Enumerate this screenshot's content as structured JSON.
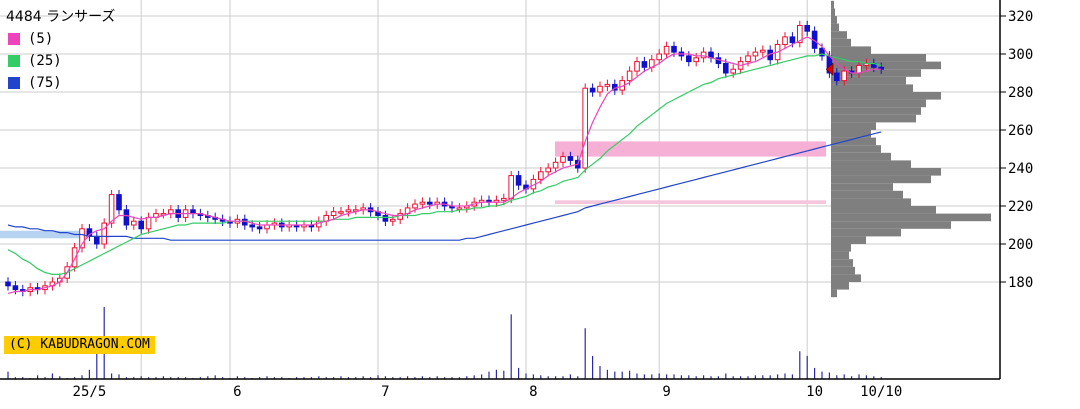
{
  "legend": {
    "title": "4484 ランサーズ",
    "items": [
      {
        "label": "(5)",
        "color": "#ee44bb"
      },
      {
        "label": "(25)",
        "color": "#33cc66"
      },
      {
        "label": "(75)",
        "color": "#2244cc"
      }
    ]
  },
  "credit": "(C) KABUDRAGON.COM",
  "chart_data": {
    "type": "candlestick",
    "ylim": [
      160,
      330
    ],
    "yticks": [
      180,
      200,
      220,
      240,
      260,
      280,
      300,
      320
    ],
    "x_labels": [
      {
        "label": "25/5",
        "index": 11
      },
      {
        "label": "6",
        "index": 31
      },
      {
        "label": "7",
        "index": 51
      },
      {
        "label": "8",
        "index": 71
      },
      {
        "label": "9",
        "index": 89
      },
      {
        "label": "10",
        "index": 109
      },
      {
        "label": "10/10",
        "index": 118
      }
    ],
    "gridlines_at_index": [
      18,
      30,
      50,
      70,
      88,
      108
    ],
    "close": [
      178,
      176,
      175,
      177,
      176,
      178,
      180,
      182,
      188,
      198,
      208,
      204,
      200,
      211,
      226,
      218,
      210,
      212,
      208,
      214,
      216,
      216,
      218,
      214,
      218,
      216,
      215,
      214,
      213,
      212,
      211,
      213,
      210,
      209,
      208,
      210,
      211,
      209,
      210,
      209,
      210,
      209,
      212,
      215,
      217,
      217,
      218,
      218,
      219,
      217,
      215,
      212,
      213,
      216,
      219,
      221,
      222,
      221,
      222,
      220,
      219,
      219,
      220,
      222,
      223,
      222,
      223,
      224,
      236,
      231,
      229,
      234,
      238,
      240,
      243,
      246,
      244,
      240,
      282,
      280,
      283,
      284,
      281,
      286,
      291,
      296,
      293,
      297,
      300,
      304,
      301,
      299,
      296,
      298,
      301,
      298,
      295,
      290,
      292,
      296,
      299,
      301,
      302,
      297,
      305,
      309,
      306,
      315,
      312,
      303,
      299,
      290,
      286,
      291,
      290,
      294,
      295,
      293,
      292
    ],
    "ma5": [
      174,
      175,
      175,
      176,
      176,
      177,
      178,
      180,
      185,
      192,
      200,
      205,
      207,
      208,
      212,
      215,
      215,
      214,
      213,
      214,
      214,
      215,
      216,
      216,
      216,
      216,
      216,
      215,
      214,
      213,
      212,
      212,
      212,
      211,
      210,
      210,
      210,
      210,
      210,
      210,
      210,
      210,
      211,
      212,
      213,
      215,
      216,
      217,
      218,
      218,
      217,
      216,
      215,
      215,
      216,
      218,
      219,
      220,
      221,
      221,
      220,
      220,
      220,
      221,
      222,
      222,
      222,
      222,
      224,
      227,
      229,
      231,
      233,
      236,
      238,
      240,
      241,
      242,
      254,
      264,
      272,
      279,
      282,
      283,
      285,
      288,
      291,
      293,
      295,
      298,
      300,
      300,
      300,
      299,
      299,
      298,
      297,
      296,
      295,
      294,
      295,
      296,
      298,
      300,
      301,
      303,
      305,
      307,
      309,
      307,
      304,
      299,
      295,
      292,
      290,
      290,
      291,
      292,
      292
    ],
    "ma25": [
      197,
      195,
      192,
      190,
      187,
      185,
      184,
      184,
      185,
      187,
      189,
      191,
      193,
      195,
      197,
      199,
      201,
      203,
      205,
      206,
      207,
      208,
      209,
      210,
      210,
      211,
      211,
      211,
      211,
      211,
      212,
      212,
      212,
      212,
      212,
      212,
      212,
      212,
      212,
      212,
      212,
      212,
      212,
      212,
      213,
      213,
      213,
      214,
      214,
      214,
      214,
      214,
      214,
      215,
      215,
      215,
      216,
      216,
      217,
      217,
      217,
      218,
      218,
      219,
      219,
      220,
      220,
      221,
      223,
      224,
      225,
      227,
      228,
      230,
      231,
      233,
      234,
      235,
      239,
      242,
      245,
      249,
      252,
      255,
      258,
      262,
      265,
      268,
      271,
      274,
      276,
      278,
      280,
      282,
      284,
      285,
      287,
      288,
      289,
      290,
      291,
      292,
      293,
      294,
      295,
      296,
      297,
      298,
      299,
      299,
      300,
      299,
      298,
      297,
      296,
      296,
      295,
      295,
      294
    ],
    "ma75": [
      210,
      209,
      209,
      208,
      208,
      207,
      207,
      206,
      206,
      205,
      205,
      204,
      204,
      204,
      204,
      204,
      204,
      203,
      203,
      203,
      203,
      203,
      202,
      202,
      202,
      202,
      202,
      202,
      202,
      202,
      202,
      202,
      202,
      202,
      202,
      202,
      202,
      202,
      202,
      202,
      202,
      202,
      202,
      202,
      202,
      202,
      202,
      202,
      202,
      202,
      202,
      202,
      202,
      202,
      202,
      202,
      202,
      202,
      202,
      202,
      202,
      202,
      203,
      203,
      204,
      205,
      206,
      207,
      208,
      209,
      210,
      211,
      212,
      213,
      214,
      215,
      216,
      217,
      219,
      220,
      221,
      222,
      223,
      224,
      225,
      226,
      227,
      228,
      229,
      230,
      231,
      232,
      233,
      234,
      235,
      236,
      237,
      238,
      239,
      240,
      241,
      242,
      243,
      244,
      245,
      246,
      247,
      248,
      249,
      250,
      251,
      252,
      253,
      254,
      255,
      256,
      257,
      258,
      259
    ],
    "volume": [
      8,
      2,
      2,
      1,
      4,
      2,
      6,
      3,
      1,
      2,
      4,
      10,
      40,
      78,
      6,
      5,
      2,
      2,
      3,
      2,
      2,
      3,
      2,
      2,
      2,
      1,
      2,
      3,
      4,
      2,
      1,
      3,
      2,
      1,
      2,
      3,
      2,
      2,
      1,
      2,
      2,
      2,
      3,
      2,
      2,
      3,
      2,
      2,
      3,
      2,
      4,
      3,
      2,
      2,
      3,
      2,
      3,
      2,
      3,
      2,
      2,
      2,
      3,
      4,
      5,
      8,
      10,
      9,
      70,
      12,
      6,
      5,
      4,
      3,
      3,
      3,
      5,
      3,
      55,
      25,
      14,
      10,
      8,
      8,
      9,
      6,
      5,
      5,
      6,
      5,
      5,
      4,
      4,
      3,
      4,
      3,
      3,
      6,
      3,
      3,
      3,
      4,
      4,
      4,
      5,
      6,
      5,
      30,
      25,
      12,
      8,
      7,
      4,
      5,
      3,
      5,
      4,
      3,
      2
    ],
    "horizontal_zones": [
      {
        "price_low": 246,
        "price_high": 254,
        "color": "#f7b0d5"
      },
      {
        "price_low": 221,
        "price_high": 223,
        "color": "#f5c7dc"
      },
      {
        "price_low": 203,
        "price_high": 207,
        "color": "#b8d3f2"
      }
    ],
    "volume_profile": [
      {
        "price": 174,
        "width": 6
      },
      {
        "price": 178,
        "width": 18
      },
      {
        "price": 182,
        "width": 30
      },
      {
        "price": 186,
        "width": 24
      },
      {
        "price": 190,
        "width": 22
      },
      {
        "price": 194,
        "width": 18
      },
      {
        "price": 198,
        "width": 20
      },
      {
        "price": 202,
        "width": 35
      },
      {
        "price": 206,
        "width": 70
      },
      {
        "price": 210,
        "width": 120
      },
      {
        "price": 214,
        "width": 160
      },
      {
        "price": 218,
        "width": 105
      },
      {
        "price": 222,
        "width": 80
      },
      {
        "price": 226,
        "width": 72
      },
      {
        "price": 230,
        "width": 62
      },
      {
        "price": 234,
        "width": 100
      },
      {
        "price": 238,
        "width": 110
      },
      {
        "price": 242,
        "width": 80
      },
      {
        "price": 246,
        "width": 60
      },
      {
        "price": 250,
        "width": 50
      },
      {
        "price": 254,
        "width": 45
      },
      {
        "price": 258,
        "width": 40
      },
      {
        "price": 262,
        "width": 45
      },
      {
        "price": 266,
        "width": 85
      },
      {
        "price": 270,
        "width": 90
      },
      {
        "price": 274,
        "width": 95
      },
      {
        "price": 278,
        "width": 110
      },
      {
        "price": 282,
        "width": 82
      },
      {
        "price": 286,
        "width": 75
      },
      {
        "price": 290,
        "width": 90
      },
      {
        "price": 294,
        "width": 110
      },
      {
        "price": 298,
        "width": 95
      },
      {
        "price": 302,
        "width": 40
      },
      {
        "price": 306,
        "width": 20
      },
      {
        "price": 310,
        "width": 16
      },
      {
        "price": 314,
        "width": 8
      },
      {
        "price": 318,
        "width": 6
      },
      {
        "price": 322,
        "width": 4
      },
      {
        "price": 326,
        "width": 3
      }
    ],
    "current_price_marker": 292,
    "colors": {
      "up": "#ee1133",
      "down": "#1111cc",
      "grid": "#cccccc",
      "profile": "#7f7f7f",
      "axis": "#000000"
    }
  }
}
